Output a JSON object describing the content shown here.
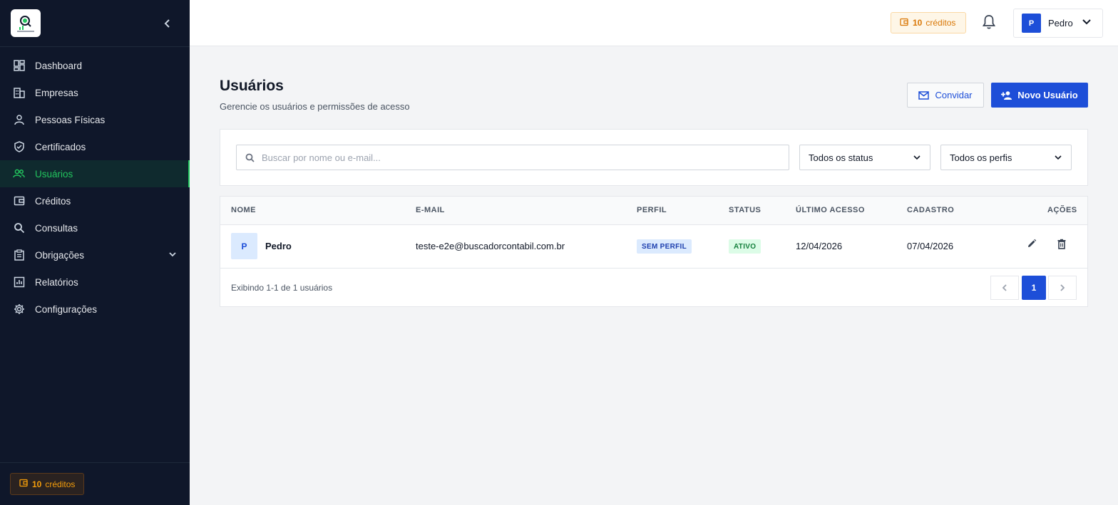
{
  "sidebar": {
    "items": [
      {
        "label": "Dashboard",
        "icon": "dashboard-icon"
      },
      {
        "label": "Empresas",
        "icon": "building-icon"
      },
      {
        "label": "Pessoas Físicas",
        "icon": "person-icon"
      },
      {
        "label": "Certificados",
        "icon": "shield-check-icon"
      },
      {
        "label": "Usuários",
        "icon": "users-icon",
        "active": true
      },
      {
        "label": "Créditos",
        "icon": "wallet-icon"
      },
      {
        "label": "Consultas",
        "icon": "search-icon"
      },
      {
        "label": "Obrigações",
        "icon": "clipboard-icon",
        "expandable": true
      },
      {
        "label": "Relatórios",
        "icon": "chart-icon"
      },
      {
        "label": "Configurações",
        "icon": "gear-icon"
      }
    ],
    "credits": {
      "amount": "10",
      "label": "créditos"
    }
  },
  "header": {
    "credits": {
      "amount": "10",
      "label": "créditos"
    },
    "user": {
      "initial": "P",
      "name": "Pedro"
    }
  },
  "page": {
    "title": "Usuários",
    "subtitle": "Gerencie os usuários e permissões de acesso",
    "invite_label": "Convidar",
    "new_user_label": "Novo Usuário"
  },
  "filters": {
    "search_placeholder": "Buscar por nome ou e-mail...",
    "status_selected": "Todos os status",
    "profile_selected": "Todos os perfis"
  },
  "table": {
    "columns": [
      "NOME",
      "E-MAIL",
      "PERFIL",
      "STATUS",
      "ÚLTIMO ACESSO",
      "CADASTRO",
      "AÇÕES"
    ],
    "rows": [
      {
        "initial": "P",
        "name": "Pedro",
        "email": "teste-e2e@buscadorcontabil.com.br",
        "profile": "SEM PERFIL",
        "status": "ATIVO",
        "last_access": "12/04/2026",
        "created": "07/04/2026"
      }
    ],
    "showing": "Exibindo 1-1 de 1 usuários",
    "current_page": "1"
  },
  "colors": {
    "sidebar_bg": "#0f172a",
    "accent_green": "#22c55e",
    "primary_blue": "#1d4ed8",
    "credit_orange": "#d97706"
  }
}
